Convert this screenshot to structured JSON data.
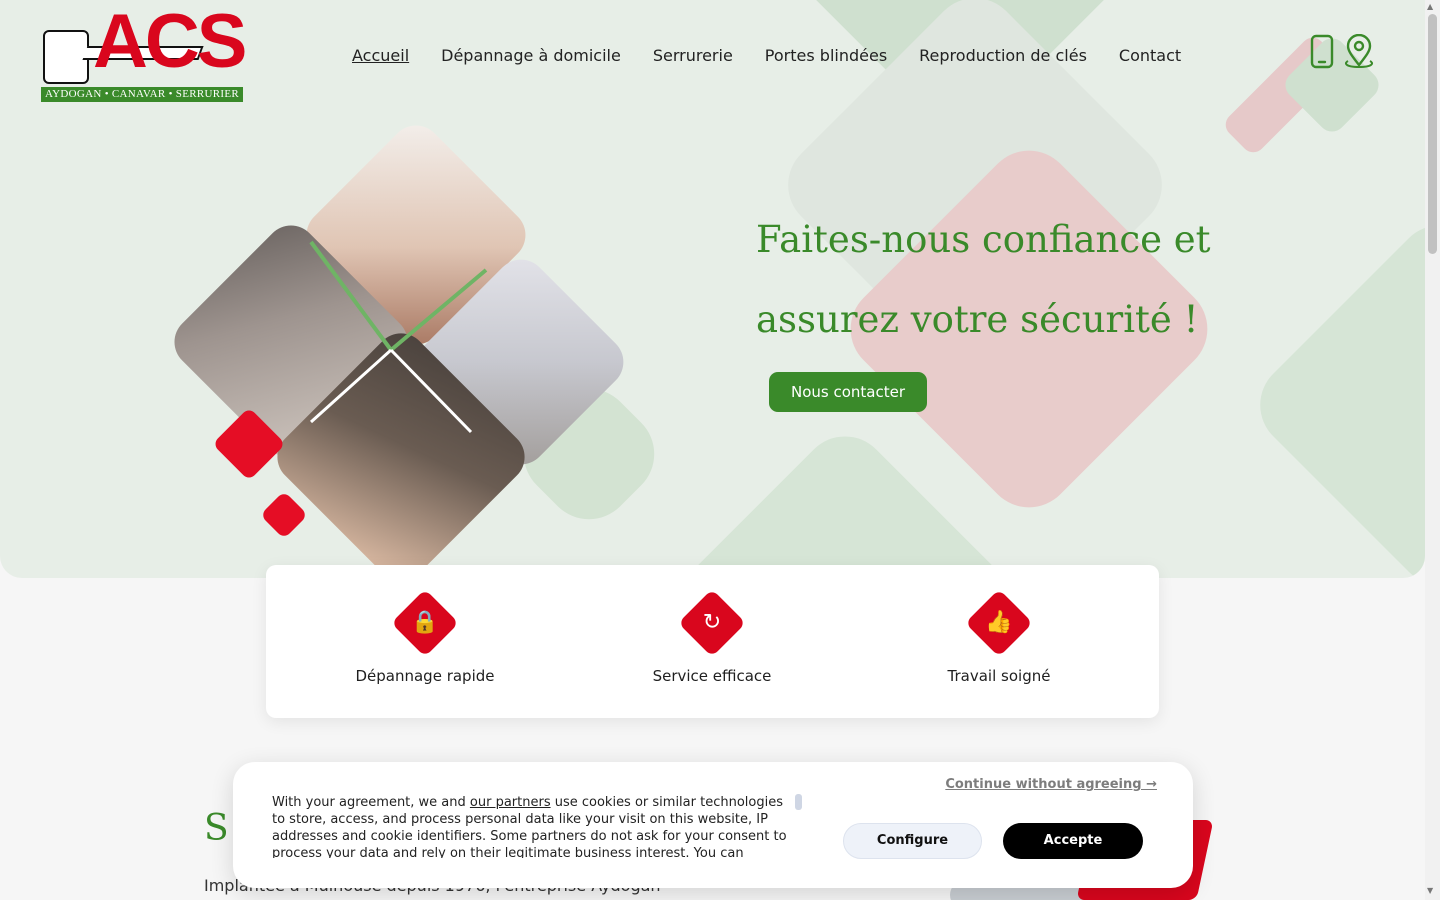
{
  "header": {
    "logo_text": "ACS",
    "logo_tagline": "AYDOGAN • CANAVAR • SERRURIER",
    "nav": [
      {
        "label": "Accueil",
        "active": true
      },
      {
        "label": "Dépannage à domicile"
      },
      {
        "label": "Serrurerie"
      },
      {
        "label": "Portes blindées"
      },
      {
        "label": "Reproduction de clés"
      },
      {
        "label": "Contact"
      }
    ],
    "icons": [
      "phone-icon",
      "location-pin-icon"
    ]
  },
  "hero": {
    "title_line1": "Faites-nous confiance et",
    "title_line2": "assurez votre sécurité !",
    "cta_label": "Nous contacter"
  },
  "features": [
    {
      "label": "Dépannage rapide",
      "icon": "lock-icon"
    },
    {
      "label": "Service efficace",
      "icon": "refresh-check-icon"
    },
    {
      "label": "Travail soigné",
      "icon": "thumbs-up-stars-icon"
    }
  ],
  "section": {
    "title_partial": "S",
    "text_partial": "Implantée à Mulhouse depuis 1976, l'entreprise Aydogan"
  },
  "cookie_banner": {
    "text_before_link": "With your agreement, we and ",
    "link_text": "our partners",
    "text_after_link": " use cookies or similar technologies to store, access, and process personal data like your visit on this website, IP addresses and cookie identifiers. Some partners do not ask for your consent to process your data and rely on their legitimate business interest. You can",
    "continue_label": "Continue without agreeing →",
    "configure_label": "Configure",
    "accept_label": "Accepte"
  },
  "colors": {
    "brand_green": "#3a8a2a",
    "brand_red": "#d9061d",
    "hero_background": "#e7eee7"
  }
}
